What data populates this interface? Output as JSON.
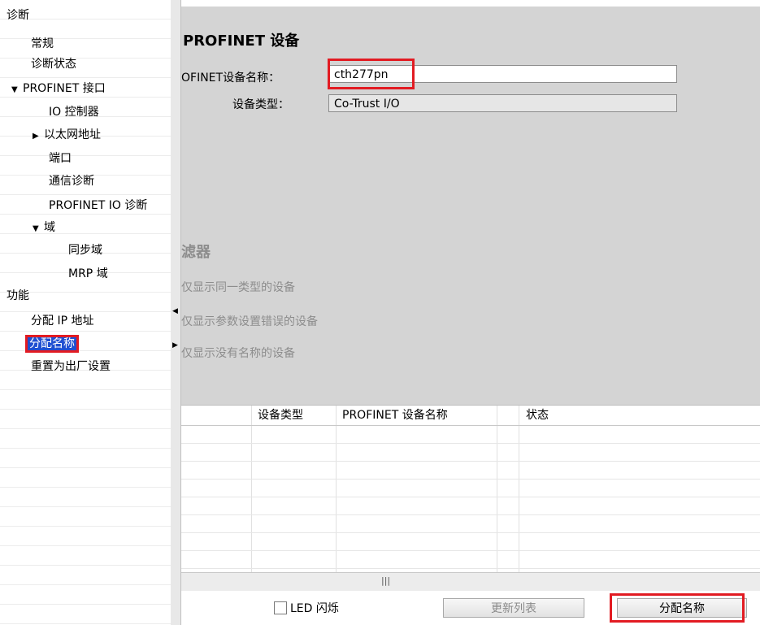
{
  "tree": {
    "items": [
      {
        "label": "诊断"
      },
      {
        "label": "常规"
      },
      {
        "label": "诊断状态"
      },
      {
        "label": "PROFINET 接口"
      },
      {
        "label": "IO 控制器"
      },
      {
        "label": "以太网地址"
      },
      {
        "label": "端口"
      },
      {
        "label": "通信诊断"
      },
      {
        "label": "PROFINET IO 诊断"
      },
      {
        "label": "域"
      },
      {
        "label": "同步域"
      },
      {
        "label": "MRP 域"
      },
      {
        "label": "功能"
      },
      {
        "label": "分配 IP 地址"
      },
      {
        "label": "分配名称"
      },
      {
        "label": "重置为出厂设置"
      }
    ]
  },
  "main": {
    "title": "PROFINET 设备",
    "device_name_label": "OFINET设备名称：",
    "device_name_value": "cth277pn",
    "device_type_label": "设备类型：",
    "device_type_value": "Co-Trust I/O",
    "filter_title": "滤器",
    "filter_options": [
      "仅显示同一类型的设备",
      "仅显示参数设置错误的设备",
      "仅显示没有名称的设备"
    ],
    "table": {
      "columns": [
        "设备类型",
        "PROFINET 设备名称",
        "状态"
      ]
    },
    "scroll_grip": "|||",
    "led_label": "LED 闪烁",
    "refresh_button": "更新列表",
    "assign_button": "分配名称"
  },
  "colors": {
    "highlight": "#e21b22",
    "selection": "#1f4fd1",
    "panel_bg": "#d4d4d4"
  }
}
